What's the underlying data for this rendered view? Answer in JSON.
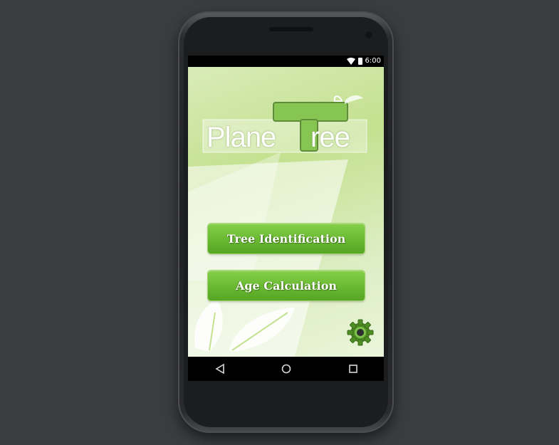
{
  "status_bar": {
    "time": "6:00",
    "icons": [
      "wifi-icon",
      "battery-icon"
    ]
  },
  "app": {
    "logo_text_a": "Plane",
    "logo_text_b": "ree",
    "buttons": {
      "tree_identification": "Tree Identification",
      "age_calculation": "Age Calculation"
    },
    "settings_icon": "gear-icon"
  },
  "navigation_bar": {
    "icons": [
      "back-icon",
      "home-icon",
      "recents-icon"
    ]
  },
  "colors": {
    "background": "#3a3d40",
    "button_green": "#6cbb34",
    "app_bg": "#c3e18f",
    "gear": "#4f8d25"
  }
}
